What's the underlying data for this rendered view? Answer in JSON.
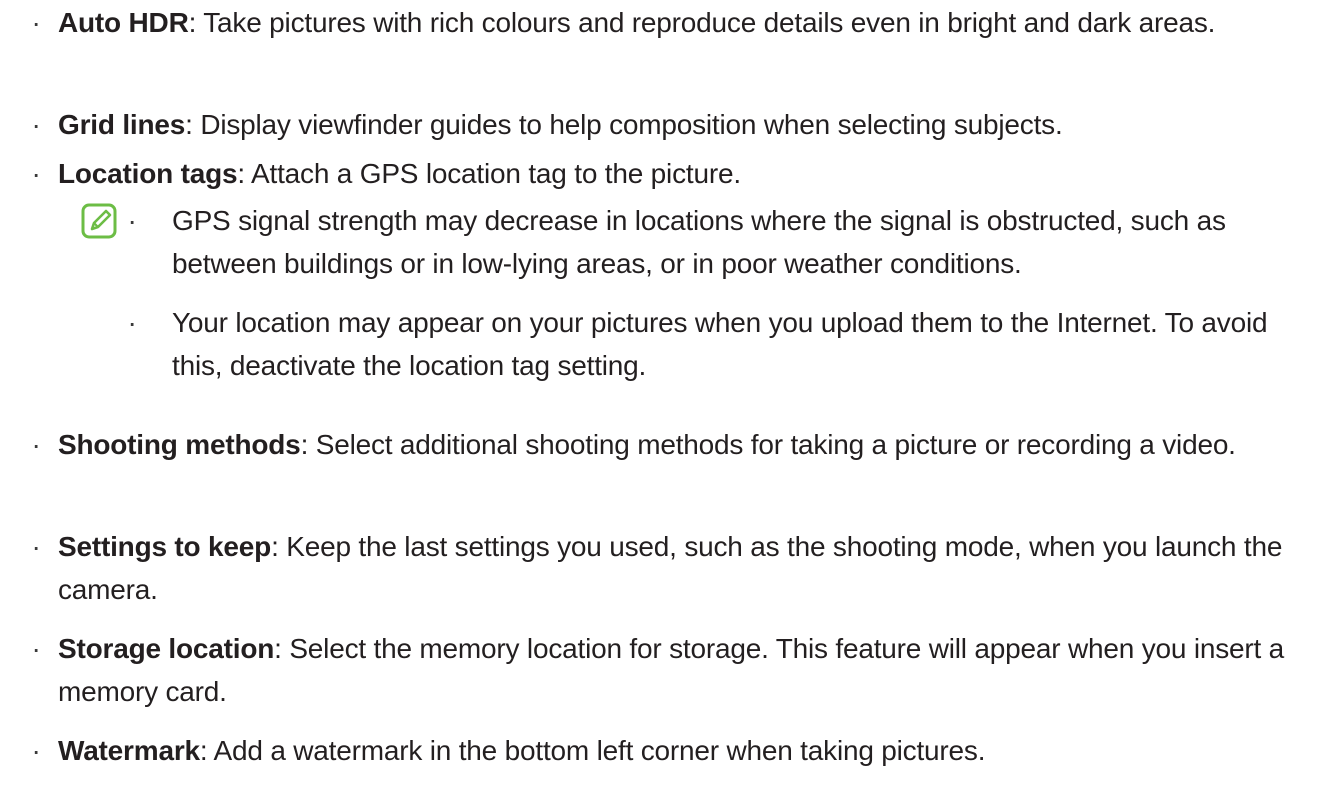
{
  "bullet_glyph": "·",
  "items": [
    {
      "term": "Auto HDR",
      "text": ": Take pictures with rich colours and reproduce details even in bright and dark areas."
    },
    {
      "term": "Grid lines",
      "text": ": Display viewfinder guides to help composition when selecting subjects."
    },
    {
      "term": "Location tags",
      "text": ": Attach a GPS location tag to the picture."
    },
    {
      "term": "Shooting methods",
      "text": ": Select additional shooting methods for taking a picture or recording a video."
    },
    {
      "term": "Settings to keep",
      "text": ": Keep the last settings you used, such as the shooting mode, when you launch the camera."
    },
    {
      "term": "Storage location",
      "text": ": Select the memory location for storage. This feature will appear when you insert a memory card."
    },
    {
      "term": "Watermark",
      "text": ": Add a watermark in the bottom left corner when taking pictures."
    }
  ],
  "note": {
    "icon": "note-pencil-icon",
    "icon_color": "#6cbd45",
    "items": [
      "GPS signal strength may decrease in locations where the signal is obstructed, such as between buildings or in low-lying areas, or in poor weather conditions.",
      "Your location may appear on your pictures when you upload them to the Internet. To avoid this, deactivate the location tag setting."
    ]
  }
}
